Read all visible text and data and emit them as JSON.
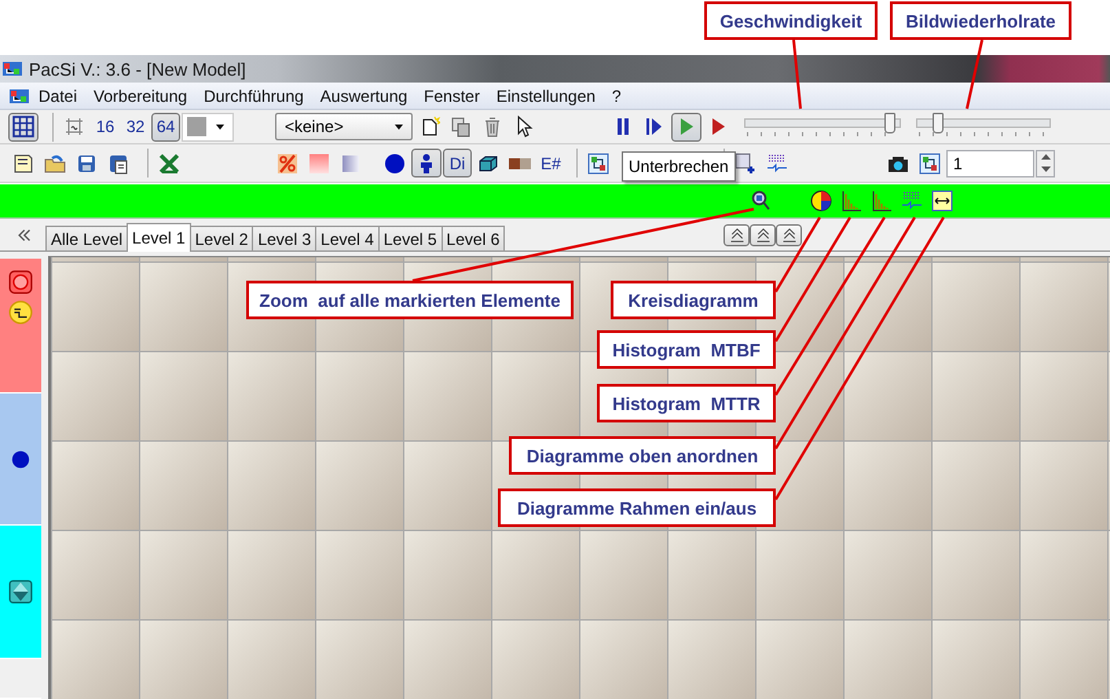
{
  "window": {
    "title": "PacSi V.: 3.6 - [New Model]"
  },
  "menu": [
    {
      "label": "Datei"
    },
    {
      "label": "Vorbereitung"
    },
    {
      "label": "Durchführung"
    },
    {
      "label": "Auswertung"
    },
    {
      "label": "Fenster"
    },
    {
      "label": "Einstellungen"
    },
    {
      "label": "?"
    }
  ],
  "toolbar1": {
    "groups": [
      [
        {
          "kind": "grid",
          "pressed": true
        }
      ],
      [
        {
          "kind": "small-grid",
          "pressed": false
        },
        {
          "kind": "text",
          "label": "16",
          "pressed": false
        },
        {
          "kind": "text",
          "label": "32",
          "pressed": false
        },
        {
          "kind": "text",
          "label": "64",
          "pressed": true
        },
        {
          "kind": "color-picker"
        }
      ],
      [
        {
          "kind": "combo",
          "value": "<keine>"
        },
        {
          "kind": "new-doc",
          "pressed": false
        },
        {
          "kind": "copy",
          "pressed": false
        },
        {
          "kind": "trash",
          "pressed": false
        },
        {
          "kind": "cursor",
          "pressed": false
        }
      ],
      [
        {
          "kind": "pause",
          "pressed": false
        },
        {
          "kind": "step",
          "pressed": false
        },
        {
          "kind": "play",
          "pressed": true
        },
        {
          "kind": "run",
          "pressed": false
        }
      ],
      [
        {
          "kind": "slider",
          "level": 0.97
        },
        {
          "kind": "slider",
          "level": 0.12
        }
      ]
    ]
  },
  "toolbar2": {
    "groups": [
      [
        {
          "kind": "new-file",
          "pressed": false
        },
        {
          "kind": "open",
          "pressed": false
        },
        {
          "kind": "save",
          "pressed": false
        },
        {
          "kind": "save-as",
          "pressed": false
        }
      ],
      [
        {
          "kind": "excel",
          "pressed": false
        }
      ],
      [
        {
          "kind": "percent",
          "pressed": false
        },
        {
          "kind": "fill",
          "pressed": false
        },
        {
          "kind": "gradient",
          "pressed": false
        }
      ],
      [
        {
          "kind": "ball",
          "pressed": false
        },
        {
          "kind": "person",
          "pressed": true
        },
        {
          "kind": "text",
          "label": "Di",
          "pressed": true
        },
        {
          "kind": "cube",
          "pressed": false
        },
        {
          "kind": "bar",
          "pressed": false
        },
        {
          "kind": "text",
          "label": "E#",
          "pressed": false
        }
      ],
      [
        {
          "kind": "network",
          "pressed": false
        }
      ],
      [
        {
          "kind": "chart-add",
          "pressed": false
        },
        {
          "kind": "network-grid",
          "pressed": false
        }
      ],
      [
        {
          "kind": "camera",
          "pressed": false
        },
        {
          "kind": "network",
          "pressed": false
        },
        {
          "kind": "spin",
          "value": "1"
        }
      ]
    ],
    "tooltip": "Unterbrechen"
  },
  "greenbar": [
    {
      "kind": "zoom"
    },
    {
      "kind": "pie"
    },
    {
      "kind": "histogram"
    },
    {
      "kind": "histogram"
    },
    {
      "kind": "network-grid"
    },
    {
      "kind": "frame"
    }
  ],
  "tabs": [
    {
      "label": "Alle Level",
      "selected": false
    },
    {
      "label": "Level 1",
      "selected": true
    },
    {
      "label": "Level 2",
      "selected": false
    },
    {
      "label": "Level 3",
      "selected": false
    },
    {
      "label": "Level 4",
      "selected": false
    },
    {
      "label": "Level 5",
      "selected": false
    },
    {
      "label": "Level 6",
      "selected": false
    }
  ],
  "level_buttons": [
    {
      "kind": "up"
    },
    {
      "kind": "up"
    },
    {
      "kind": "up"
    }
  ],
  "palette": [
    {
      "color": "#ff8080",
      "items": [
        {
          "kind": "machine"
        },
        {
          "kind": "repair"
        }
      ]
    },
    {
      "color": "#a8c8f0",
      "items": [
        {
          "kind": "ball"
        }
      ]
    },
    {
      "color": "#00ffff",
      "items": [
        {
          "kind": "diamond"
        }
      ]
    },
    {
      "color": "#f0f0f0"
    }
  ],
  "callouts": [
    {
      "text": "Geschwindigkeit"
    },
    {
      "text": "Bildwiederholrate"
    },
    {
      "text": "Zoom  auf alle markierten Elemente"
    },
    {
      "text": "Kreisdiagramm"
    },
    {
      "text": "Histogram  MTBF"
    },
    {
      "text": "Histogram  MTTR"
    },
    {
      "text": "Diagramme oben anordnen"
    },
    {
      "text": "Diagramme Rahmen ein/aus"
    }
  ]
}
